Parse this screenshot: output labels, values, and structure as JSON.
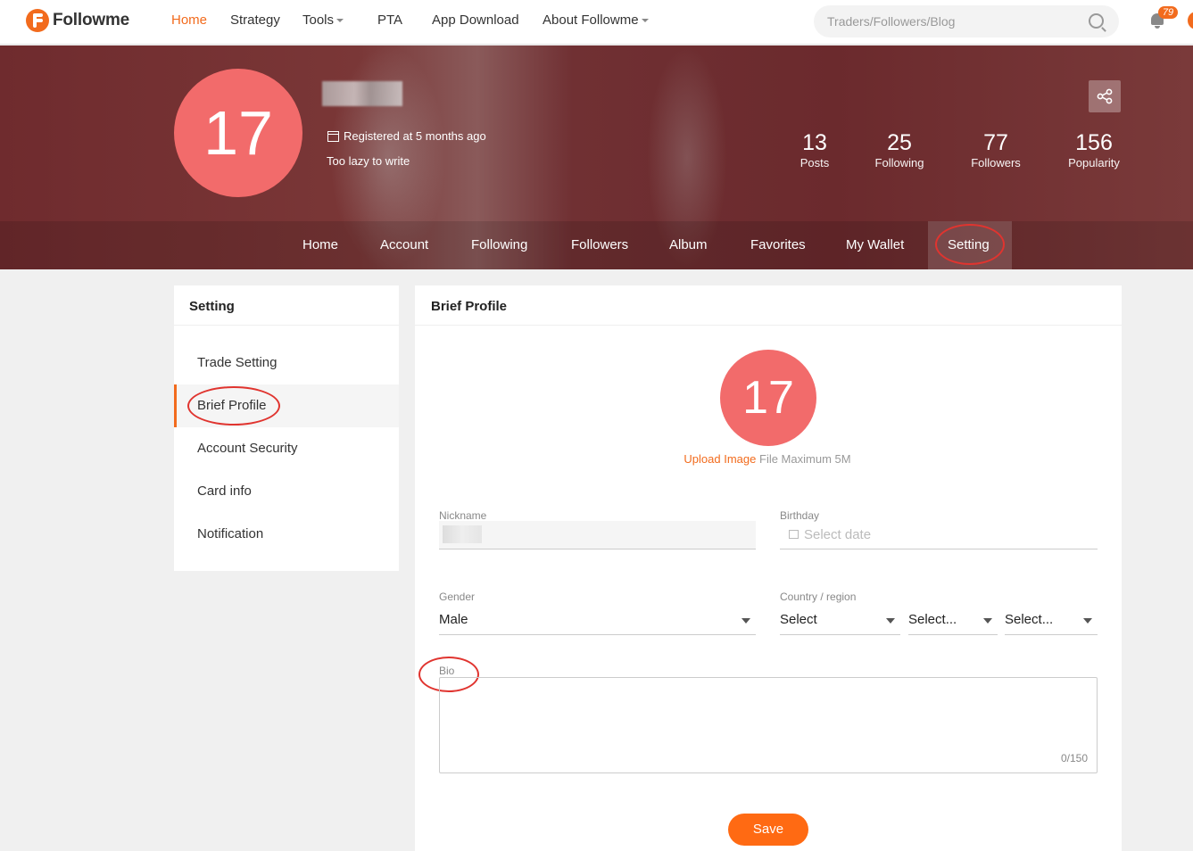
{
  "header": {
    "logo": "Followme",
    "nav": [
      {
        "label": "Home"
      },
      {
        "label": "Strategy"
      },
      {
        "label": "Tools"
      },
      {
        "label": "PTA"
      },
      {
        "label": "App Download"
      },
      {
        "label": "About Followme"
      }
    ],
    "active_nav": "Home",
    "search_placeholder": "Traders/Followers/Blog",
    "notification_count": "79",
    "accent_color": "#f26b1d"
  },
  "profile": {
    "avatar_text": "17",
    "registered": "Registered at 5 months ago",
    "bio": "Too lazy to write",
    "stats": [
      {
        "value": "13",
        "label": "Posts"
      },
      {
        "value": "25",
        "label": "Following"
      },
      {
        "value": "77",
        "label": "Followers"
      },
      {
        "value": "156",
        "label": "Popularity"
      }
    ],
    "tabs": [
      {
        "label": "Home"
      },
      {
        "label": "Account"
      },
      {
        "label": "Following"
      },
      {
        "label": "Followers"
      },
      {
        "label": "Album"
      },
      {
        "label": "Favorites"
      },
      {
        "label": "My Wallet"
      },
      {
        "label": "Setting"
      }
    ],
    "active_tab": "Setting"
  },
  "sidebar": {
    "title": "Setting",
    "items": [
      {
        "label": "Trade Setting"
      },
      {
        "label": "Brief Profile"
      },
      {
        "label": "Account Security"
      },
      {
        "label": "Card info"
      },
      {
        "label": "Notification"
      }
    ],
    "active_item": "Brief Profile"
  },
  "form": {
    "title": "Brief Profile",
    "avatar_text": "17",
    "upload_link": "Upload Image",
    "upload_note": "File Maximum 5M",
    "nickname_label": "Nickname",
    "birthday_label": "Birthday",
    "birthday_placeholder": "Select date",
    "gender_label": "Gender",
    "gender_value": "Male",
    "country_label": "Country / region",
    "country_value": "Select",
    "region_value": "Select...",
    "city_value": "Select...",
    "bio_label": "Bio",
    "bio_counter": "0/150",
    "save_label": "Save"
  }
}
